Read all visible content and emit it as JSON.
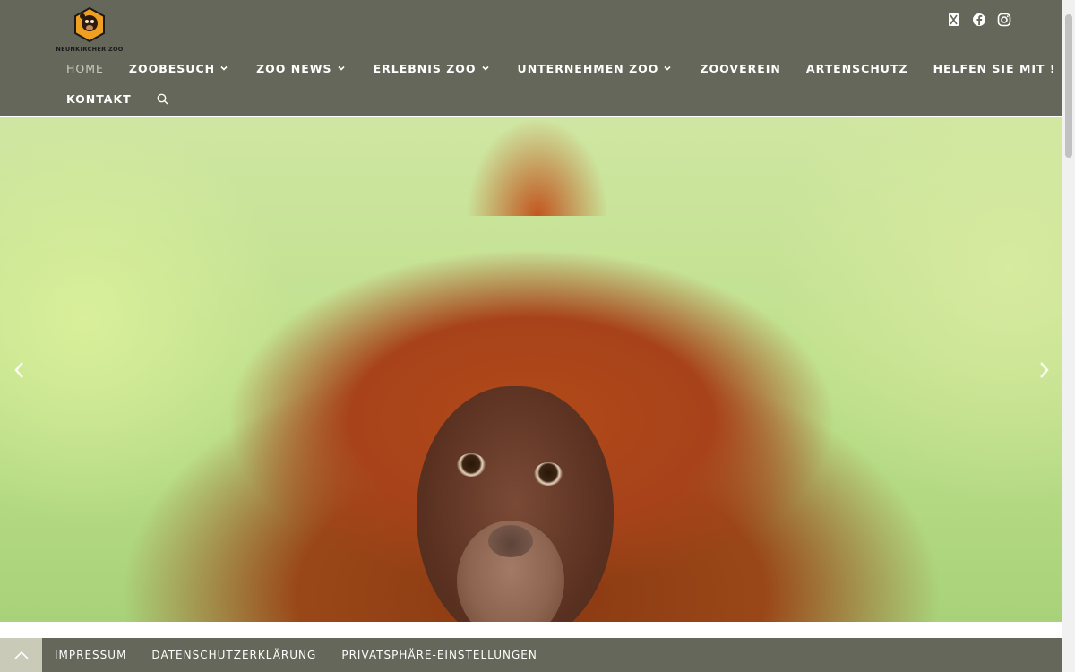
{
  "logo": {
    "text": "NEUNKIRCHER ZOO"
  },
  "social": [
    {
      "name": "x-icon"
    },
    {
      "name": "facebook-icon"
    },
    {
      "name": "instagram-icon"
    }
  ],
  "nav": {
    "row1": [
      {
        "label": "HOME",
        "active": true,
        "dropdown": false
      },
      {
        "label": "ZOOBESUCH",
        "dropdown": true
      },
      {
        "label": "ZOO NEWS",
        "dropdown": true
      },
      {
        "label": "ERLEBNIS ZOO",
        "dropdown": true
      },
      {
        "label": "UNTERNEHMEN ZOO",
        "dropdown": true
      },
      {
        "label": "ZOOVEREIN",
        "dropdown": false
      },
      {
        "label": "ARTENSCHUTZ",
        "dropdown": false
      },
      {
        "label": "HELFEN SIE MIT !",
        "dropdown": true
      }
    ],
    "row2": [
      {
        "label": "KONTAKT",
        "dropdown": false
      }
    ]
  },
  "footer": {
    "links": [
      "IMPRESSUM",
      "DATENSCHUTZERKLÄRUNG",
      "PRIVATSPHÄRE-EINSTELLUNGEN"
    ]
  },
  "colors": {
    "header_bg": "#646759",
    "footer_bg": "#646759",
    "scroll_top_bg": "#c9cab8",
    "nav_active": "#c9cbbf"
  }
}
